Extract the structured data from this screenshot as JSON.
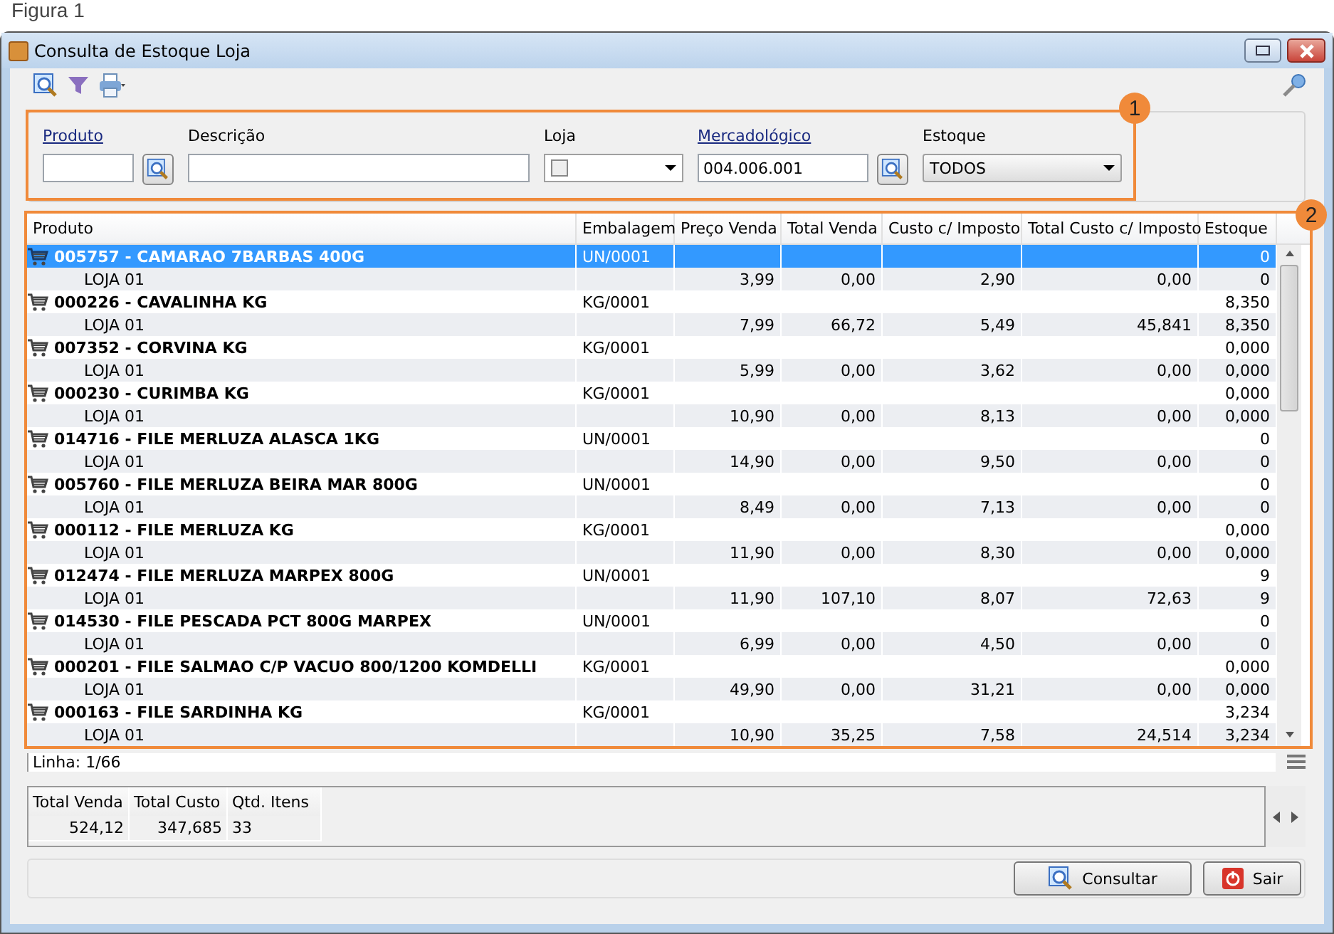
{
  "caption": "Figura 1",
  "window": {
    "title": "Consulta de Estoque Loja"
  },
  "filters": {
    "badge": "1",
    "produto": {
      "label": "Produto"
    },
    "descricao": {
      "label": "Descrição"
    },
    "loja": {
      "label": "Loja",
      "checked": false
    },
    "mercadologico": {
      "label": "Mercadológico",
      "value": "004.006.001"
    },
    "estoque": {
      "label": "Estoque",
      "value": "TODOS"
    }
  },
  "table": {
    "badge": "2",
    "columns": [
      "Produto",
      "Embalagem",
      "Preço Venda",
      "Total Venda",
      "Custo c/ Imposto",
      "Total Custo c/ Imposto",
      "Estoque"
    ],
    "products": [
      {
        "name": "005757 - CAMARAO 7BARBAS 400G",
        "embalagem": "UN/0001",
        "estoque": "0",
        "selected": true,
        "store": {
          "name": "LOJA 01",
          "preco": "3,99",
          "total_venda": "0,00",
          "custo": "2,90",
          "total_custo": "0,00",
          "estoque": "0"
        }
      },
      {
        "name": "000226 - CAVALINHA KG",
        "embalagem": "KG/0001",
        "estoque": "8,350",
        "selected": false,
        "store": {
          "name": "LOJA 01",
          "preco": "7,99",
          "total_venda": "66,72",
          "custo": "5,49",
          "total_custo": "45,841",
          "estoque": "8,350"
        }
      },
      {
        "name": "007352 - CORVINA KG",
        "embalagem": "KG/0001",
        "estoque": "0,000",
        "selected": false,
        "store": {
          "name": "LOJA 01",
          "preco": "5,99",
          "total_venda": "0,00",
          "custo": "3,62",
          "total_custo": "0,00",
          "estoque": "0,000"
        }
      },
      {
        "name": "000230 - CURIMBA KG",
        "embalagem": "KG/0001",
        "estoque": "0,000",
        "selected": false,
        "store": {
          "name": "LOJA 01",
          "preco": "10,90",
          "total_venda": "0,00",
          "custo": "8,13",
          "total_custo": "0,00",
          "estoque": "0,000"
        }
      },
      {
        "name": "014716 - FILE MERLUZA ALASCA 1KG",
        "embalagem": "UN/0001",
        "estoque": "0",
        "selected": false,
        "store": {
          "name": "LOJA 01",
          "preco": "14,90",
          "total_venda": "0,00",
          "custo": "9,50",
          "total_custo": "0,00",
          "estoque": "0"
        }
      },
      {
        "name": "005760 - FILE MERLUZA BEIRA MAR 800G",
        "embalagem": "UN/0001",
        "estoque": "0",
        "selected": false,
        "store": {
          "name": "LOJA 01",
          "preco": "8,49",
          "total_venda": "0,00",
          "custo": "7,13",
          "total_custo": "0,00",
          "estoque": "0"
        }
      },
      {
        "name": "000112 - FILE MERLUZA KG",
        "embalagem": "KG/0001",
        "estoque": "0,000",
        "selected": false,
        "store": {
          "name": "LOJA 01",
          "preco": "11,90",
          "total_venda": "0,00",
          "custo": "8,30",
          "total_custo": "0,00",
          "estoque": "0,000"
        }
      },
      {
        "name": "012474 - FILE MERLUZA MARPEX 800G",
        "embalagem": "UN/0001",
        "estoque": "9",
        "selected": false,
        "store": {
          "name": "LOJA 01",
          "preco": "11,90",
          "total_venda": "107,10",
          "custo": "8,07",
          "total_custo": "72,63",
          "estoque": "9"
        }
      },
      {
        "name": "014530 - FILE PESCADA PCT 800G MARPEX",
        "embalagem": "UN/0001",
        "estoque": "0",
        "selected": false,
        "store": {
          "name": "LOJA 01",
          "preco": "6,99",
          "total_venda": "0,00",
          "custo": "4,50",
          "total_custo": "0,00",
          "estoque": "0"
        }
      },
      {
        "name": "000201 - FILE SALMAO C/P VACUO 800/1200 KOMDELLI",
        "embalagem": "KG/0001",
        "estoque": "0,000",
        "selected": false,
        "store": {
          "name": "LOJA 01",
          "preco": "49,90",
          "total_venda": "0,00",
          "custo": "31,21",
          "total_custo": "0,00",
          "estoque": "0,000"
        }
      },
      {
        "name": "000163 - FILE SARDINHA KG",
        "embalagem": "KG/0001",
        "estoque": "3,234",
        "selected": false,
        "store": {
          "name": "LOJA 01",
          "preco": "10,90",
          "total_venda": "35,25",
          "custo": "7,58",
          "total_custo": "24,514",
          "estoque": "3,234"
        }
      }
    ]
  },
  "status": "Linha: 1/66",
  "totals": {
    "columns": [
      "Total Venda",
      "Total Custo",
      "Qtd. Itens"
    ],
    "values": [
      "524,12",
      "347,685",
      "33"
    ]
  },
  "buttons": [
    "Consultar",
    "Sair"
  ]
}
